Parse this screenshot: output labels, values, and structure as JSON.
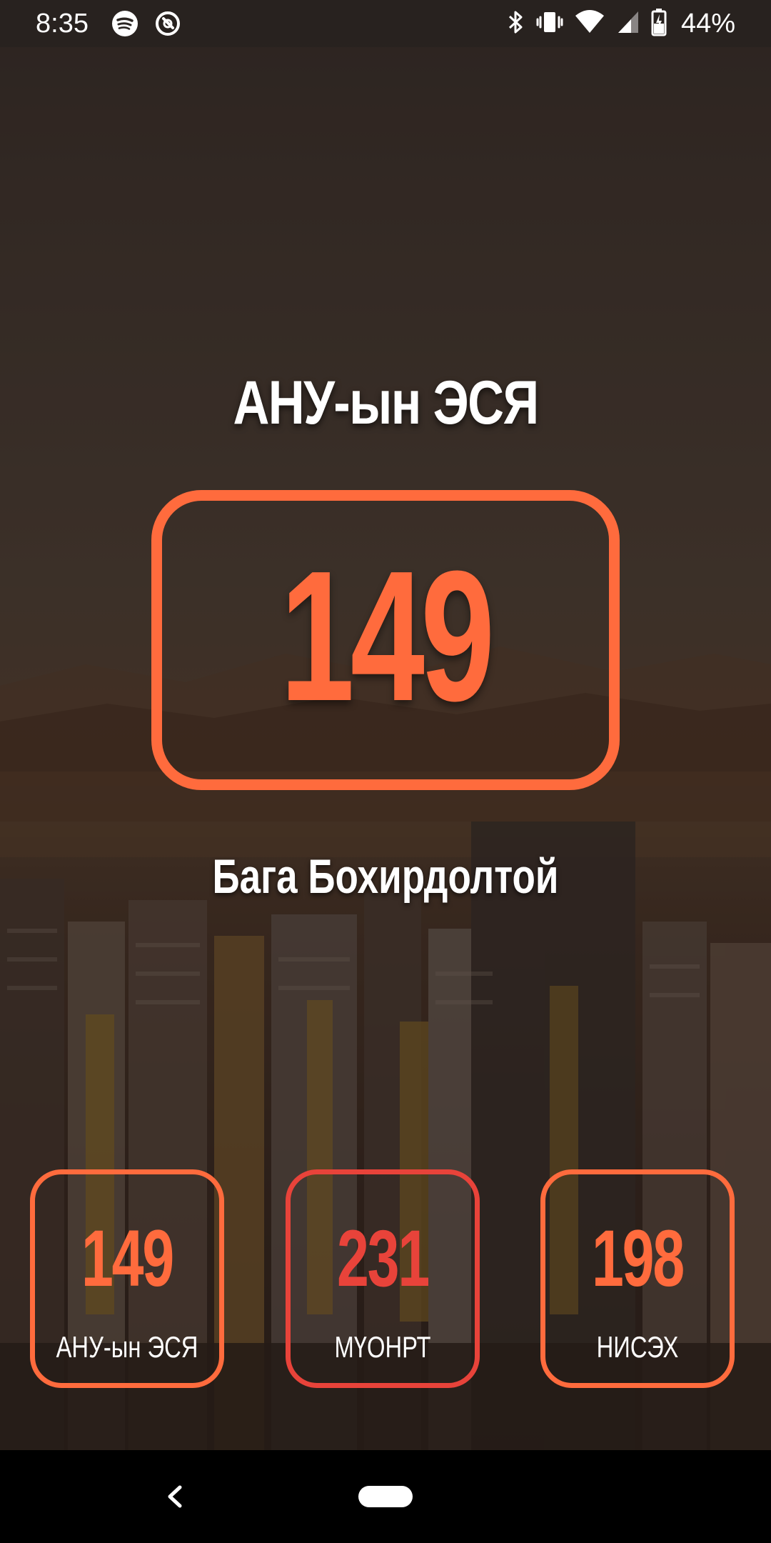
{
  "status_bar": {
    "time": "8:35",
    "left_icons": [
      "spotify-icon",
      "app-notification-icon"
    ],
    "right_icons": [
      "bluetooth-icon",
      "vibrate-icon",
      "wifi-icon",
      "cellular-signal-icon",
      "battery-charging-icon"
    ],
    "battery_percent": "44%"
  },
  "main": {
    "title": "АНУ-ын ЭСЯ",
    "value": "149",
    "status": "Бага Бохирдолтой",
    "accent_color": "#ff6b3d"
  },
  "stations": [
    {
      "value": "149",
      "label": "АНУ-ын ЭСЯ",
      "color": "#ff6b3d"
    },
    {
      "value": "231",
      "label": "МҮОНРТ",
      "color": "#e8433a"
    },
    {
      "value": "198",
      "label": "НИСЭХ",
      "color": "#ff6b3d"
    }
  ],
  "nav": {
    "icons": [
      "back-icon",
      "home-pill-icon"
    ]
  }
}
